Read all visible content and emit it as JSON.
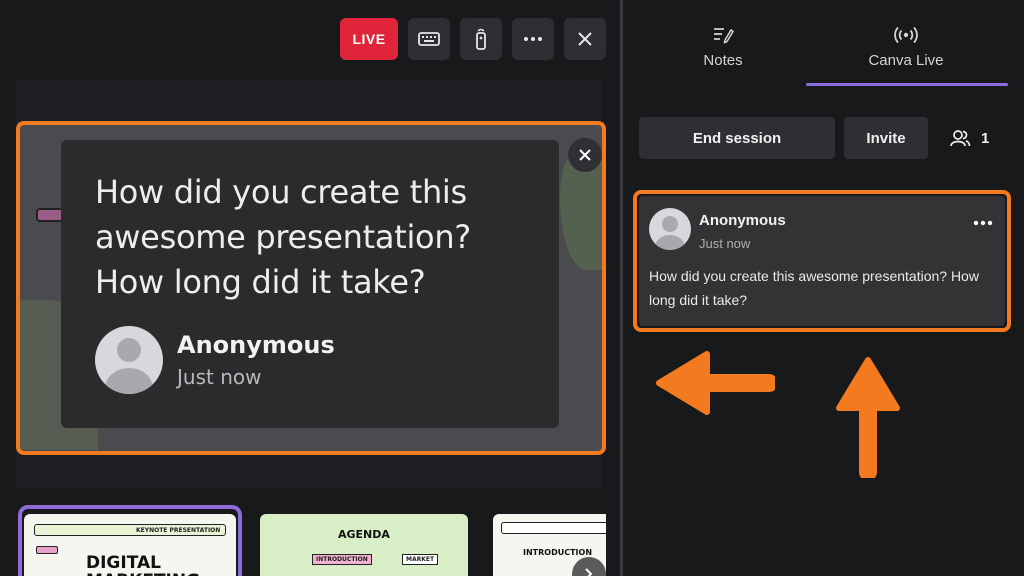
{
  "toolbar": {
    "live_label": "LIVE",
    "icons": [
      "keyboard-icon",
      "remote-icon",
      "more-icon",
      "close-icon"
    ]
  },
  "question_card": {
    "text": "How did you create this awesome presentation? How long did it take?",
    "author": "Anonymous",
    "time": "Just now"
  },
  "thumbnails": [
    {
      "title": "DIGITAL MARKETING",
      "subtitle": "KEYNOTE PRESENTATION"
    },
    {
      "title": "AGENDA",
      "items": [
        "INTRODUCTION",
        "MARKET"
      ]
    },
    {
      "title": "INTRODUCTION"
    }
  ],
  "right_panel": {
    "tabs": [
      {
        "label": "Notes",
        "icon": "notes-icon"
      },
      {
        "label": "Canva Live",
        "icon": "broadcast-icon"
      }
    ],
    "active_tab": "Canva Live",
    "end_session_label": "End session",
    "invite_label": "Invite",
    "participant_count": "1",
    "question": {
      "author": "Anonymous",
      "time": "Just now",
      "text": "How did you create this awesome presentation? How long did it take?"
    }
  },
  "colors": {
    "accent_orange": "#f47a1f",
    "live_red": "#e0243a",
    "tab_purple": "#8b6ce0"
  }
}
